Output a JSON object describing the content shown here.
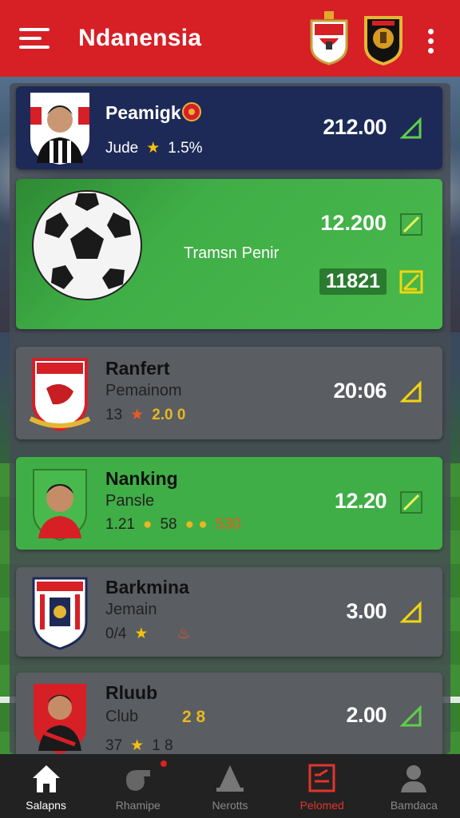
{
  "header": {
    "title": "Ndanensia",
    "menu_icon": "hamburger-menu-icon",
    "more_icon": "kebab-menu-icon",
    "brand_color": "#d71f26"
  },
  "featured": {
    "label": "Tramsn Penir",
    "price_top": "12.200",
    "price_bottom": "11821",
    "icon": "soccer-ball-icon"
  },
  "items": [
    {
      "name": "Peamigk",
      "sub": "Jude",
      "rating": "1.5%",
      "price": "212.00"
    },
    {
      "name": "Ranfert",
      "sub": "Pemainom",
      "meta_a": "13",
      "meta_b": "2.0 0",
      "price": "20:06"
    },
    {
      "name": "Nanking",
      "sub": "Pansle",
      "meta_a": "1.21",
      "meta_b": "58",
      "meta_c": "530",
      "price": "12.20"
    },
    {
      "name": "Barkmina",
      "sub": "Jemain",
      "meta_a": "0/4",
      "price": "3.00"
    },
    {
      "name": "Rluub",
      "sub": "Club",
      "meta_a": "37",
      "meta_b": "2 8",
      "meta_c": "1 8",
      "price": "2.00"
    }
  ],
  "nav": [
    {
      "label": "Salapns",
      "icon": "home-icon"
    },
    {
      "label": "Rhamipe",
      "icon": "whistle-icon"
    },
    {
      "label": "Nerotts",
      "icon": "cone-icon"
    },
    {
      "label": "Pelomed",
      "icon": "clipboard-icon"
    },
    {
      "label": "Bamdaca",
      "icon": "profile-icon"
    }
  ],
  "colors": {
    "navy_card": "#1d2a57",
    "green_card": "#3fae46",
    "grey_card": "#5a5d62",
    "check_green": "#5fcf4a",
    "check_yellow": "#f2d60e"
  }
}
